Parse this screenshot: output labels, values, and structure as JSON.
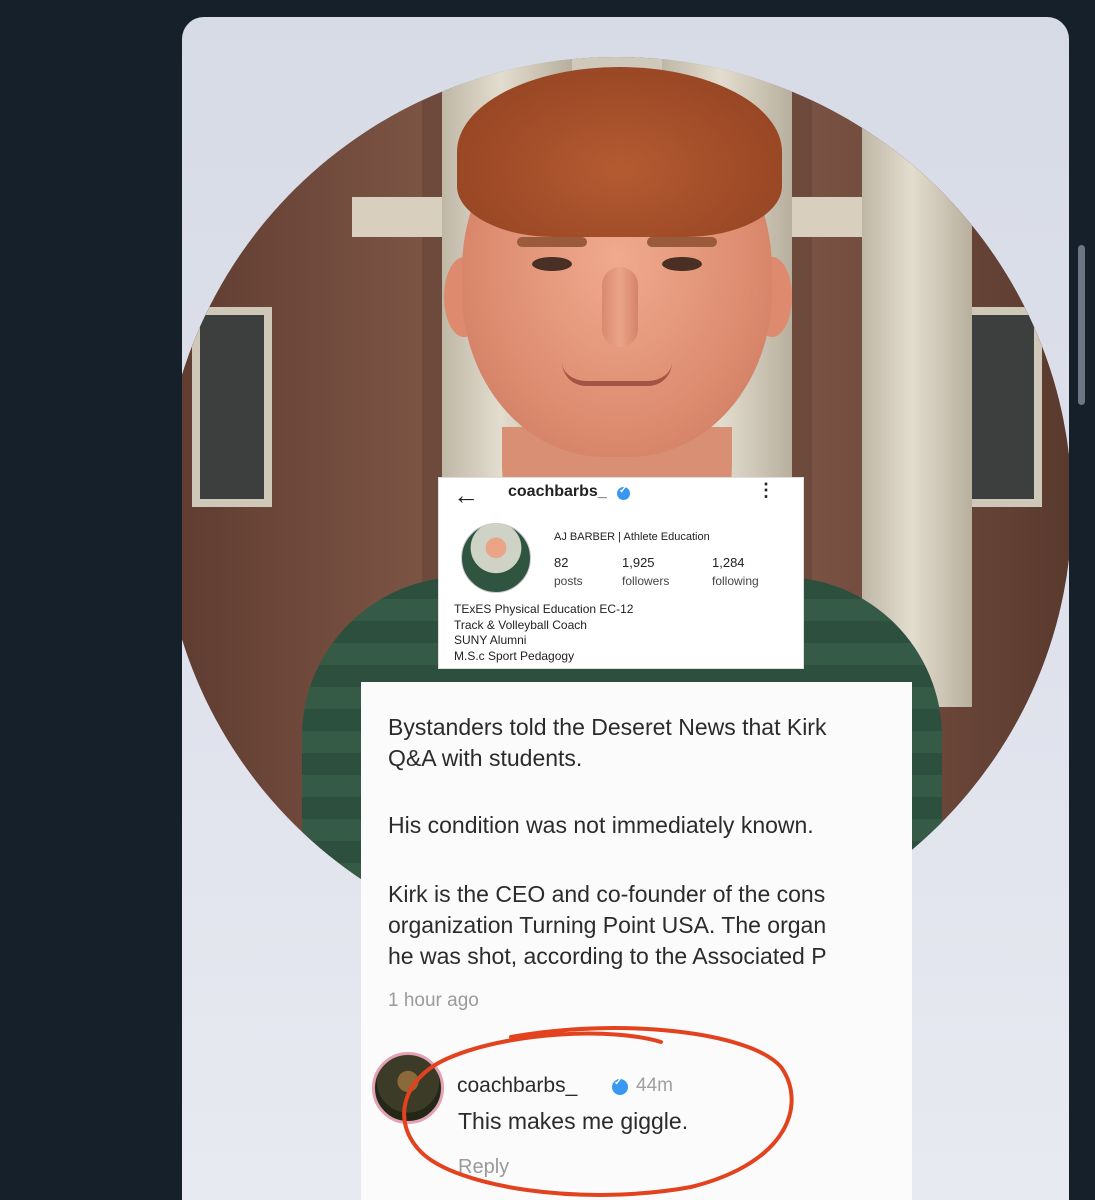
{
  "photo": {
    "alt": "profile photo of a smiling man in front of a building with columns"
  },
  "instagram": {
    "back_icon": "←",
    "handle": "coachbarbs_",
    "menu_icon": "⋮",
    "name": "AJ BARBER | Athlete Education",
    "stats": [
      {
        "value": "82",
        "label": "posts"
      },
      {
        "value": "1,925",
        "label": "followers"
      },
      {
        "value": "1,284",
        "label": "following"
      }
    ],
    "bio": [
      "TExES Physical Education EC-12",
      "Track & Volleyball Coach",
      "SUNY Alumni",
      "M.S.c Sport Pedagogy"
    ]
  },
  "article": {
    "line1": "Bystanders told the Deseret News that Kirk",
    "line2": "Q&A with students.",
    "line3": "His condition was not immediately known.",
    "line4": "Kirk is the CEO and co-founder of the cons",
    "line5": "organization Turning Point USA. The organ",
    "line6": "he was shot, according to the Associated P",
    "time": "1 hour ago"
  },
  "comment": {
    "handle": "coachbarbs_",
    "time": "44m",
    "text": "This makes me giggle.",
    "reply_label": "Reply"
  },
  "colors": {
    "background": "#16202a",
    "verified": "#3897f0",
    "annotation_red": "#e2421d"
  }
}
